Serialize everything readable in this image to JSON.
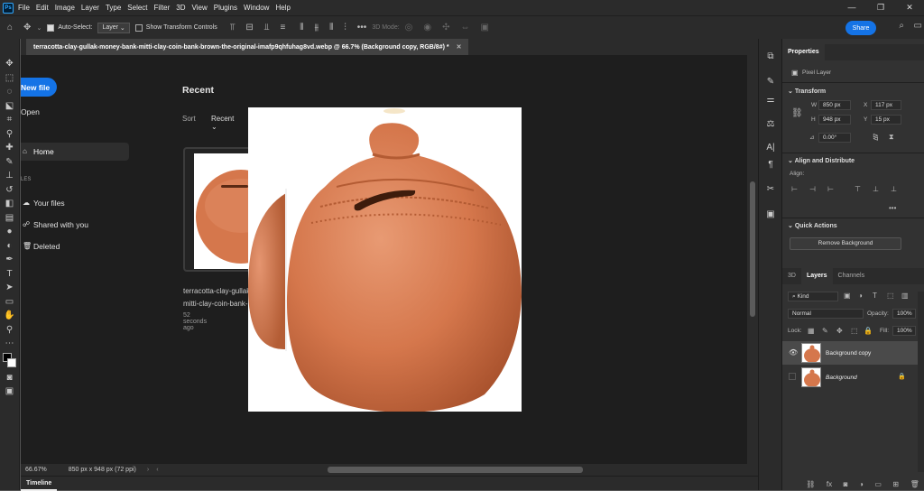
{
  "app": {
    "logo_text": "Ps"
  },
  "menu": [
    "File",
    "Edit",
    "Image",
    "Layer",
    "Type",
    "Select",
    "Filter",
    "3D",
    "View",
    "Plugins",
    "Window",
    "Help"
  ],
  "window_controls": {
    "minimize": "—",
    "maximize": "❐",
    "close": "✕"
  },
  "options_bar": {
    "auto_select_label": "Auto-Select:",
    "auto_select_value": "Layer",
    "transform_controls_label": "Show Transform Controls",
    "mode_3d_label": "3D Mode:",
    "share_label": "Share"
  },
  "document": {
    "tab_title": "terracotta-clay-gullak-money-bank-mitti-clay-coin-bank-brown-the-original-imafp9qhfuhag8vd.webp @ 66.7% (Background copy, RGB/8#) *",
    "zoom": "66.67%",
    "dimensions": "850 px x 948 px (72 ppi)"
  },
  "home": {
    "new_file": "New file",
    "open": "Open",
    "home": "Home",
    "files_section": "LES",
    "your_files": "Your files",
    "shared": "Shared with you",
    "deleted": "Deleted",
    "recent_title": "Recent",
    "sort_label": "Sort",
    "sort_value": "Recent",
    "card_name_line1": "terracotta-clay-gullak-money-bank-",
    "card_name_line2": "mitti-clay-coin-bank-brown-the",
    "card_time": "52 seconds ago"
  },
  "properties": {
    "tab": "Properties",
    "layer_type": "Pixel Layer",
    "transform_title": "Transform",
    "w_label": "W",
    "w_value": "850 px",
    "h_label": "H",
    "h_value": "948 px",
    "x_label": "X",
    "x_value": "117 px",
    "y_label": "Y",
    "y_value": "15 px",
    "angle_value": "0.00°",
    "align_title": "Align and Distribute",
    "align_label": "Align:",
    "quick_title": "Quick Actions",
    "remove_bg": "Remove Background"
  },
  "layers_panel": {
    "tabs": [
      "3D",
      "Layers",
      "Channels"
    ],
    "kind_label": "Kind",
    "blend_mode": "Normal",
    "opacity_label": "Opacity:",
    "opacity_value": "100%",
    "lock_label": "Lock:",
    "fill_label": "Fill:",
    "fill_value": "100%",
    "layers": [
      {
        "name": "Background copy",
        "visible": true,
        "selected": true
      },
      {
        "name": "Background",
        "visible": false,
        "locked": true
      }
    ]
  },
  "timeline_label": "Timeline",
  "colors": {
    "accent": "#1473e6",
    "pot": "#d9825a"
  }
}
